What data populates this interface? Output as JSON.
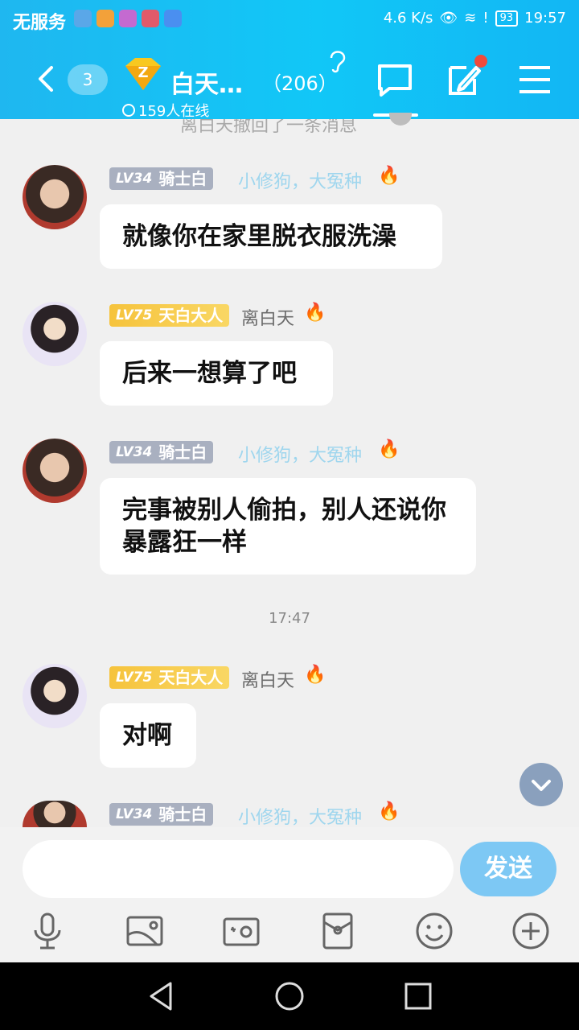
{
  "status_bar": {
    "carrier": "无服务",
    "speed": "4.6 K/s",
    "battery": "93",
    "time": "19:57"
  },
  "header": {
    "unread_count": "3",
    "title": "白天…",
    "member_count": "（206）",
    "online": "159人在线"
  },
  "recall_notice": "离白天撤回了一条消息",
  "messages": [
    {
      "level": "LV34",
      "title": "骑士白",
      "nick": "小修狗，大冤种",
      "text": "就像你在家里脱衣服洗澡"
    },
    {
      "level": "LV75",
      "title": "天白大人",
      "nick": "离白天",
      "text": "后来一想算了吧"
    },
    {
      "level": "LV34",
      "title": "骑士白",
      "nick": "小修狗，大冤种",
      "text": "完事被别人偷拍，别人还说你暴露狂一样"
    },
    {
      "level": "LV75",
      "title": "天白大人",
      "nick": "离白天",
      "text": "对啊"
    },
    {
      "level": "LV34",
      "title": "骑士白",
      "nick": "小修狗，大冤种"
    }
  ],
  "timestamp": "17:47",
  "input": {
    "placeholder": "",
    "send_label": "发送"
  },
  "colors": {
    "header": "#12b6f4",
    "send": "#7dc8f4",
    "level_grey": "#a9b0c0",
    "level_gold": "#f6c33c"
  }
}
